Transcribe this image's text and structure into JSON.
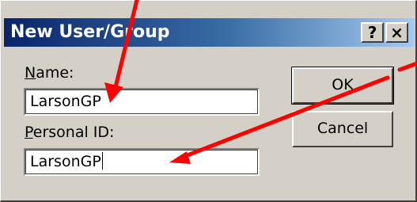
{
  "window": {
    "title": "New User/Group",
    "help_glyph": "?",
    "close_glyph": "×"
  },
  "form": {
    "name_label": "Name:",
    "name_value": "LarsonGP",
    "personal_id_label": "Personal ID:",
    "personal_id_value": "LarsonGP"
  },
  "buttons": {
    "ok": "OK",
    "cancel": "Cancel"
  },
  "annotation": {
    "arrow_color": "#ff0000"
  }
}
